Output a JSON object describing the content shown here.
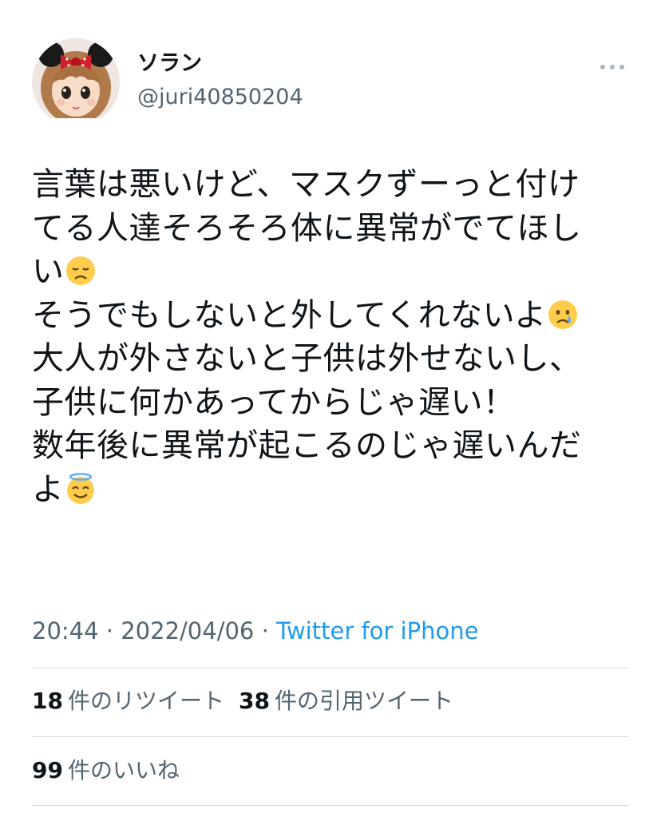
{
  "user": {
    "display_name": "ソラン",
    "handle": "@juri40850204",
    "avatar": "doll-with-mouse-ears-avatar"
  },
  "tweet": {
    "lines": [
      {
        "text": "言葉は悪いけど、マスクずーっと付け",
        "emoji": ""
      },
      {
        "text": "てる人達そろそろ体に異常がでてほし",
        "emoji": ""
      },
      {
        "text": "い",
        "emoji": "disappointed-face"
      },
      {
        "text": "そうでもしないと外してくれないよ",
        "emoji": "crying-face"
      },
      {
        "text": "大人が外さないと子供は外せないし、",
        "emoji": ""
      },
      {
        "text": "子供に何かあってからじゃ遅い！",
        "emoji": ""
      },
      {
        "text": "数年後に異常が起こるのじゃ遅いんだ",
        "emoji": ""
      },
      {
        "text": "よ",
        "emoji": "smiling-face-with-halo"
      }
    ]
  },
  "meta": {
    "time": "20:44",
    "separator": " · ",
    "date": "2022/04/06",
    "source": "Twitter for iPhone"
  },
  "stats": {
    "retweets_count": "18",
    "retweets_label": "件のリツイート",
    "quotes_count": "38",
    "quotes_label": "件の引用ツイート",
    "likes_count": "99",
    "likes_label": "件のいいね"
  },
  "colors": {
    "text": "#0f1419",
    "secondary": "#536471",
    "link": "#1d9bf0",
    "divider": "#d6dbdf"
  }
}
